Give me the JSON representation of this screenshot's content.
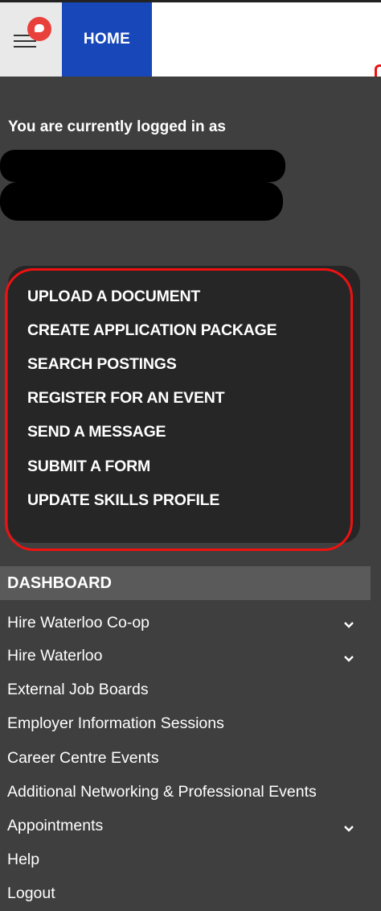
{
  "header": {
    "home_label": "HOME"
  },
  "user": {
    "logged_in_text": "You are currently logged in as"
  },
  "quick_actions": [
    "UPLOAD A DOCUMENT",
    "CREATE APPLICATION PACKAGE",
    "SEARCH POSTINGS",
    "REGISTER FOR AN EVENT",
    "SEND A MESSAGE",
    "SUBMIT A FORM",
    "UPDATE SKILLS PROFILE"
  ],
  "nav": {
    "section_title": "DASHBOARD",
    "items": [
      "Hire Waterloo Co-op",
      "Hire Waterloo",
      "External Job Boards",
      "Employer Information Sessions",
      "Career Centre Events",
      "Additional Networking & Professional Events",
      "Appointments",
      "Help",
      "Logout"
    ]
  },
  "colors": {
    "home_tab": "#1747b8",
    "panel": "#3f3f3f",
    "highlight": "#e11111",
    "notification": "#e8413c"
  }
}
